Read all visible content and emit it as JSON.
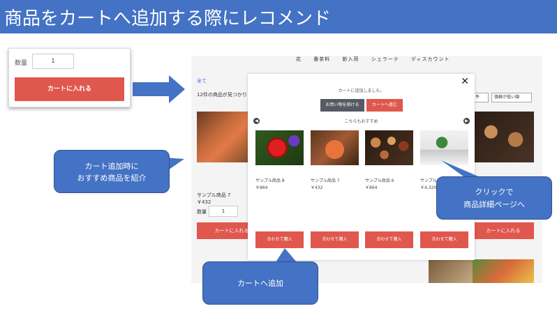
{
  "slide": {
    "title": "商品をカートへ追加する際にレコメンド"
  },
  "left_card": {
    "qty_label": "数量",
    "qty_value": "1",
    "add_to_cart_label": "カートに入れる"
  },
  "shop": {
    "nav_items": [
      "花",
      "番茶料",
      "新入荷",
      "シェラーテ",
      "ディスカウント"
    ],
    "breadcrumb": "全て",
    "result_count": "12件の商品が見つかり",
    "sort_select_1": "件",
    "sort_select_2": "価格が低い順",
    "product_name": "サンプル商品 7",
    "product_price": "￥432",
    "qty_label": "数量",
    "qty_value": "1",
    "add_to_cart_label": "カートに入れる"
  },
  "modal": {
    "close_label": "✕",
    "message": "カートに追加しました。",
    "continue_label": "お買い物を続ける",
    "go_to_cart_label": "カートへ進む",
    "recommend_title": "こちらもおすすめ",
    "prev_label": "◀",
    "next_label": "▶",
    "products": [
      {
        "name": "サンプル商品 8",
        "price": "￥864",
        "image": "red-rose",
        "buy_label": "合わせて購入"
      },
      {
        "name": "サンプル商品 7",
        "price": "￥432",
        "image": "salmon-fillet",
        "buy_label": "合わせて購入"
      },
      {
        "name": "サンプル商品 6",
        "price": "￥864",
        "image": "spice-bowls",
        "buy_label": "合わせて購入"
      },
      {
        "name": "サンプル商品",
        "price": "￥4,320",
        "image": "potted-plant",
        "buy_label": "合わせて購入"
      }
    ]
  },
  "callouts": {
    "recommend_line1": "カート追加時に",
    "recommend_line2": "おすすめ商品を紹介",
    "detail_line1": "クリックで",
    "detail_line2": "商品詳細ページへ",
    "add_to_cart": "カートへ追加"
  },
  "colors": {
    "accent_blue": "#4472c4",
    "button_red": "#e0574e",
    "button_dark": "#555a63"
  }
}
